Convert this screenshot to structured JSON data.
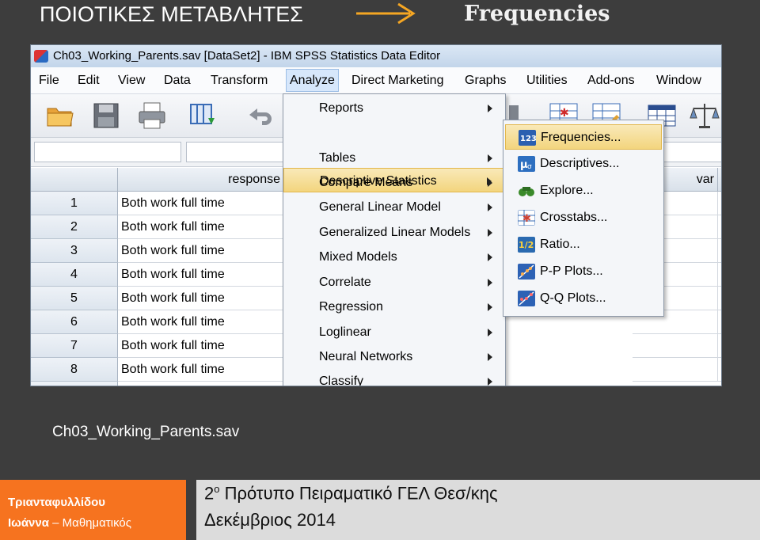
{
  "slide": {
    "title": "ΠΟΙΟΤΙΚΕΣ ΜΕΤΑΒΛΗΤΕΣ",
    "subtitle": "Frequencies",
    "caption": "Ch03_Working_Parents.sav"
  },
  "window": {
    "title": "Ch03_Working_Parents.sav [DataSet2] - IBM SPSS Statistics Data Editor"
  },
  "menubar": [
    "File",
    "Edit",
    "View",
    "Data",
    "Transform",
    "Analyze",
    "Direct Marketing",
    "Graphs",
    "Utilities",
    "Add-ons",
    "Window"
  ],
  "active_menu": "Analyze",
  "toolbar_icons": [
    "open-folder-icon",
    "save-disk-icon",
    "print-icon",
    "recall-dialog-icon",
    "undo-icon",
    "select-cases-icon",
    "split-file-icon",
    "value-labels-icon",
    "split-table-icon",
    "scale-icon"
  ],
  "grid": {
    "column_header": "response",
    "extra_column_header": "var",
    "rows": [
      {
        "num": "1",
        "value": "Both work full time"
      },
      {
        "num": "2",
        "value": "Both work full time"
      },
      {
        "num": "3",
        "value": "Both work full time"
      },
      {
        "num": "4",
        "value": "Both work full time"
      },
      {
        "num": "5",
        "value": "Both work full time"
      },
      {
        "num": "6",
        "value": "Both work full time"
      },
      {
        "num": "7",
        "value": "Both work full time"
      },
      {
        "num": "8",
        "value": "Both work full time"
      }
    ]
  },
  "analyze_menu": [
    "Reports",
    "Descriptive Statistics",
    "Tables",
    "Compare Means",
    "General Linear Model",
    "Generalized Linear Models",
    "Mixed Models",
    "Correlate",
    "Regression",
    "Loglinear",
    "Neural Networks",
    "Classify"
  ],
  "highlighted_menu_item": "Descriptive Statistics",
  "descriptive_submenu": [
    {
      "label": "Frequencies...",
      "icon": "frequencies-123-icon",
      "color": "#2b5fb0"
    },
    {
      "label": "Descriptives...",
      "icon": "descriptives-icon",
      "color": "#2d6fc0"
    },
    {
      "label": "Explore...",
      "icon": "explore-binoculars-icon",
      "color": "#3a8a2a"
    },
    {
      "label": "Crosstabs...",
      "icon": "crosstabs-icon",
      "color": "#d04030"
    },
    {
      "label": "Ratio...",
      "icon": "ratio-half-icon",
      "color": "#2a6ab0"
    },
    {
      "label": "P-P Plots...",
      "icon": "pp-plot-icon",
      "color": "#2d62b5"
    },
    {
      "label": "Q-Q Plots...",
      "icon": "qq-plot-icon",
      "color": "#2d62b5"
    }
  ],
  "highlighted_submenu_item": "Frequencies...",
  "footer": {
    "author_line1": "Τριανταφυλλίδου",
    "author_line2_bold": "Ιωάννα",
    "author_line2_rest": " – Μαθηματικός",
    "school_num": "2",
    "school_sup": "ο",
    "school_rest": " Πρότυπο Πειραματικό ΓΕΛ Θεσ/κης",
    "date": "Δεκέμβριος 2014"
  },
  "colors": {
    "slide_bg": "#3d3d3d",
    "arrow": "#f5a623",
    "footer_orange": "#f6731f",
    "footer_gray": "#dcdcdc",
    "menu_highlight": "#f3d57e"
  }
}
